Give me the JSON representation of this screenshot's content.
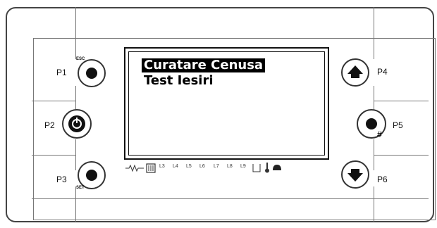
{
  "buttons": [
    {
      "id": "p1",
      "label": "P1",
      "sub": "ESC"
    },
    {
      "id": "p2",
      "label": "P2",
      "sub": ""
    },
    {
      "id": "p3",
      "label": "P3",
      "sub": "SET"
    },
    {
      "id": "p4",
      "label": "P4",
      "sub": ""
    },
    {
      "id": "p5",
      "label": "P5",
      "sub": "#"
    },
    {
      "id": "p6",
      "label": "P6",
      "sub": ""
    }
  ],
  "display": {
    "menu_items": [
      "Curatare Cenusa",
      "Test Iesiri"
    ],
    "selected_index": 0
  },
  "indicators": [
    "L3",
    "L4",
    "L5",
    "L6",
    "L7",
    "L8",
    "L9"
  ]
}
